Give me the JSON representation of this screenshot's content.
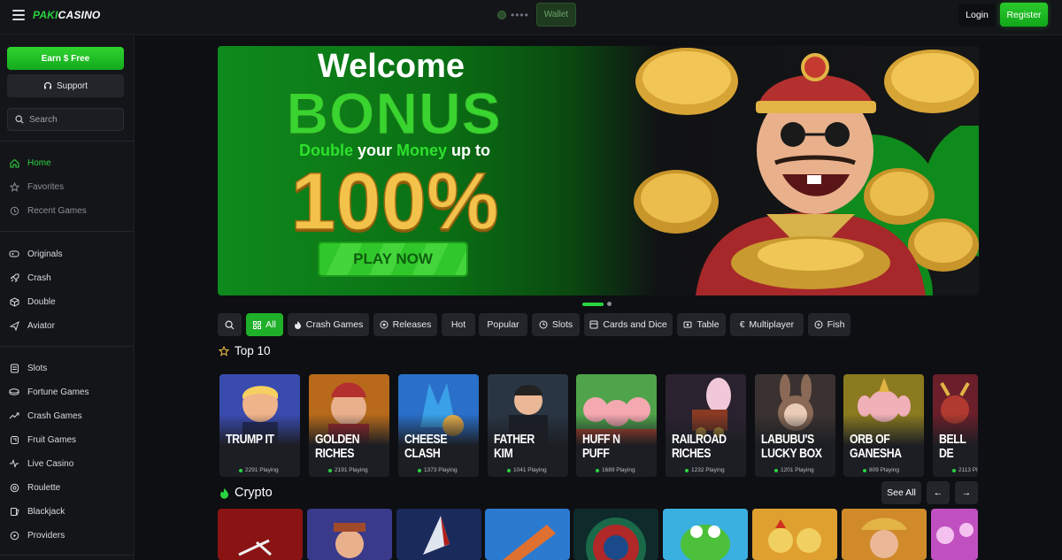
{
  "header": {
    "logo_part1": "PAKI",
    "logo_part2": "CASINO",
    "balance_masked": "••••",
    "wallet_label": "Wallet",
    "login_label": "Login",
    "register_label": "Register"
  },
  "sidebar": {
    "earn_label": "Earn $ Free",
    "support_label": "Support",
    "search_placeholder": "Search",
    "group1": [
      {
        "label": "Home",
        "icon": "home-icon"
      },
      {
        "label": "Favorites",
        "icon": "star-icon"
      },
      {
        "label": "Recent Games",
        "icon": "clock-icon"
      }
    ],
    "group2": [
      {
        "label": "Originals",
        "icon": "gamepad-icon"
      },
      {
        "label": "Crash",
        "icon": "rocket-icon"
      },
      {
        "label": "Double",
        "icon": "cube-icon"
      },
      {
        "label": "Aviator",
        "icon": "plane-icon"
      }
    ],
    "group3": [
      {
        "label": "Slots",
        "icon": "slots-icon"
      },
      {
        "label": "Fortune Games",
        "icon": "fortune-icon"
      },
      {
        "label": "Crash Games",
        "icon": "trend-icon"
      },
      {
        "label": "Fruit Games",
        "icon": "fruit-icon"
      },
      {
        "label": "Live Casino",
        "icon": "pulse-icon"
      },
      {
        "label": "Roulette",
        "icon": "roulette-icon"
      },
      {
        "label": "Blackjack",
        "icon": "cards-icon"
      },
      {
        "label": "Providers",
        "icon": "play-circle-icon"
      }
    ]
  },
  "banner": {
    "welcome": "Welcome",
    "bonus": "BONUS",
    "double": "Double",
    "your": "your",
    "money": "Money",
    "up_to": "up to",
    "percent": "100%",
    "play_now": "PLAY NOW",
    "accent": "#2bd33f",
    "gold": "#f2c24a"
  },
  "categories": [
    {
      "label": "",
      "icon": "search-icon"
    },
    {
      "label": "All",
      "icon": "grid-icon",
      "active": true
    },
    {
      "label": "Crash Games",
      "icon": "flame-icon"
    },
    {
      "label": "Releases",
      "icon": "new-icon"
    },
    {
      "label": "Hot",
      "icon": ""
    },
    {
      "label": "Popular",
      "icon": ""
    },
    {
      "label": "Slots",
      "icon": "slots-icon"
    },
    {
      "label": "Cards and Dice",
      "icon": "cards-icon"
    },
    {
      "label": "Table",
      "icon": "table-icon"
    },
    {
      "label": "Multiplayer",
      "icon": "euro-icon"
    },
    {
      "label": "Fish",
      "icon": "fish-icon"
    }
  ],
  "top10": {
    "title": "Top 10",
    "games": [
      {
        "name": "TRUMP IT",
        "playing": "2291 Playing"
      },
      {
        "name": "GOLDEN RICHES",
        "playing": "2191 Playing"
      },
      {
        "name": "CHEESE CLASH",
        "playing": "1373 Playing"
      },
      {
        "name": "FATHER KIM",
        "playing": "1041 Playing"
      },
      {
        "name": "HUFF N PUFF",
        "playing": "1689 Playing"
      },
      {
        "name": "RAILROAD RICHES",
        "playing": "1232 Playing"
      },
      {
        "name": "LABUBU'S LUCKY BOX",
        "playing": "1201 Playing"
      },
      {
        "name": "ORB OF GANESHA",
        "playing": "809 Playing"
      },
      {
        "name": "BELL DE",
        "playing": "2113 Pl"
      }
    ]
  },
  "crypto": {
    "title": "Crypto",
    "see_all": "See All",
    "prev": "←",
    "next": "→"
  }
}
